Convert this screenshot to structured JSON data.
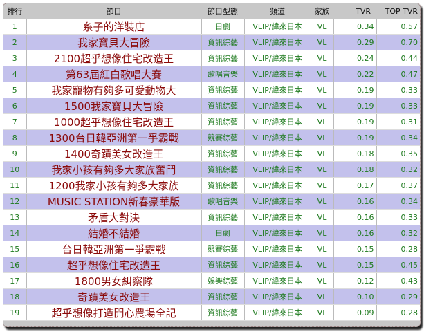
{
  "headers": [
    "排行",
    "節目",
    "節目型態",
    "頻道",
    "家族",
    "TVR",
    "TOP TVR"
  ],
  "rows": [
    [
      "1",
      "糸子的洋裝店",
      "日劇",
      "VLIP/緯來日本",
      "VL",
      "0.34",
      "0.57"
    ],
    [
      "2",
      "我家寶貝大冒險",
      "資訊綜藝",
      "VLIP/緯來日本",
      "VL",
      "0.29",
      "0.70"
    ],
    [
      "3",
      "2100超乎想像住宅改造王",
      "資訊綜藝",
      "VLIP/緯來日本",
      "VL",
      "0.24",
      "0.44"
    ],
    [
      "4",
      "第63屆紅白歌唱大賽",
      "歌唱音樂",
      "VLIP/緯來日本",
      "VL",
      "0.22",
      "0.47"
    ],
    [
      "5",
      "我家寵物有夠多可愛動物大",
      "資訊綜藝",
      "VLIP/緯來日本",
      "VL",
      "0.19",
      "0.33"
    ],
    [
      "6",
      "1500我家寶貝大冒險",
      "資訊綜藝",
      "VLIP/緯來日本",
      "VL",
      "0.19",
      "0.33"
    ],
    [
      "7",
      "1000超乎想像住宅改造王",
      "資訊綜藝",
      "VLIP/緯來日本",
      "VL",
      "0.19",
      "0.31"
    ],
    [
      "8",
      "1300台日韓亞洲第一爭霸戰",
      "競賽綜藝",
      "VLIP/緯來日本",
      "VL",
      "0.19",
      "0.34"
    ],
    [
      "9",
      "1400奇蹟美女改造王",
      "資訊綜藝",
      "VLIP/緯來日本",
      "VL",
      "0.18",
      "0.35"
    ],
    [
      "10",
      "我家小孩有夠多大家族奮鬥",
      "資訊綜藝",
      "VLIP/緯來日本",
      "VL",
      "0.18",
      "0.32"
    ],
    [
      "11",
      "1200我家小孩有夠多大家族",
      "資訊綜藝",
      "VLIP/緯來日本",
      "VL",
      "0.17",
      "0.37"
    ],
    [
      "12",
      "MUSIC STATION新春豪華版",
      "歌唱音樂",
      "VLIP/緯來日本",
      "VL",
      "0.16",
      "0.34"
    ],
    [
      "13",
      "矛盾大對決",
      "資訊綜藝",
      "VLIP/緯來日本",
      "VL",
      "0.16",
      "0.33"
    ],
    [
      "14",
      "結婚不結婚",
      "日劇",
      "VLIP/緯來日本",
      "VL",
      "0.16",
      "0.32"
    ],
    [
      "15",
      "台日韓亞洲第一爭霸戰",
      "競賽綜藝",
      "VLIP/緯來日本",
      "VL",
      "0.15",
      "0.28"
    ],
    [
      "16",
      "超乎想像住宅改造王",
      "資訊綜藝",
      "VLIP/緯來日本",
      "VL",
      "0.15",
      "0.45"
    ],
    [
      "17",
      "1800男女糾察隊",
      "娛樂綜藝",
      "VLIP/緯來日本",
      "VL",
      "0.12",
      "0.43"
    ],
    [
      "18",
      "奇蹟美女改造王",
      "資訊綜藝",
      "VLIP/緯來日本",
      "VL",
      "0.10",
      "0.29"
    ],
    [
      "19",
      "超乎想像打造開心農場全記",
      "資訊綜藝",
      "VLIP/緯來日本",
      "VL",
      "0.09",
      "0.28"
    ]
  ]
}
